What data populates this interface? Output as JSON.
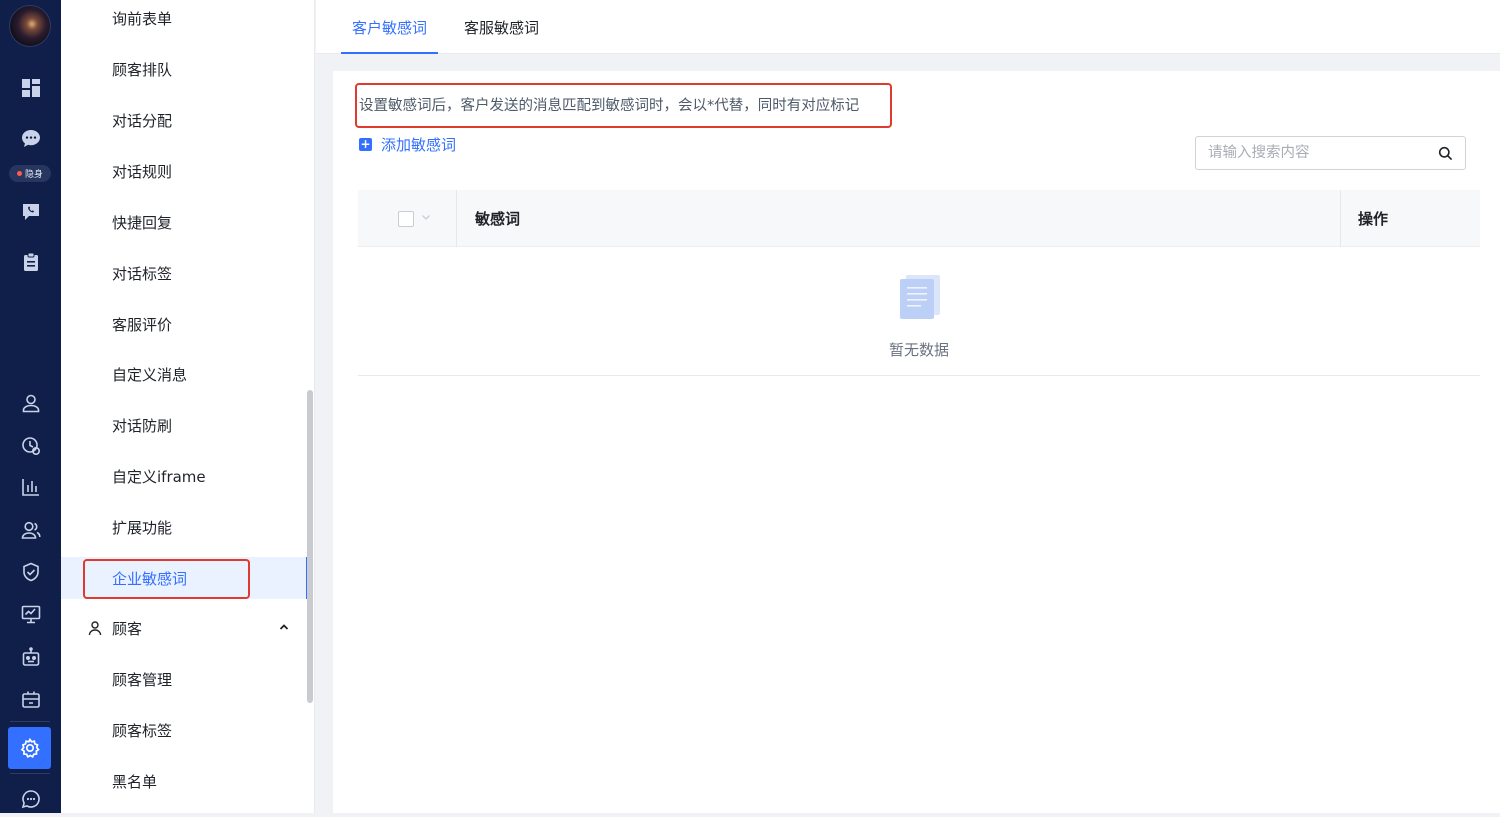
{
  "rail": {
    "status_label": "隐身",
    "icons": [
      "dashboard-icon",
      "chat-icon",
      "phone-chat-icon",
      "clipboard-icon",
      "user-icon",
      "history-icon",
      "bar-chart-icon",
      "team-icon",
      "shield-icon",
      "monitor-icon",
      "robot-icon",
      "grid-app-icon",
      "settings-icon",
      "message-icon"
    ],
    "colors": {
      "background": "#0f1f4a",
      "active": "#3370ff",
      "status_dot": "#ff5a4e"
    }
  },
  "menu": {
    "items": [
      {
        "label": "询前表单"
      },
      {
        "label": "顾客排队"
      },
      {
        "label": "对话分配"
      },
      {
        "label": "对话规则"
      },
      {
        "label": "快捷回复"
      },
      {
        "label": "对话标签"
      },
      {
        "label": "客服评价"
      },
      {
        "label": "自定义消息"
      },
      {
        "label": "对话防刷"
      },
      {
        "label": "自定义iframe"
      },
      {
        "label": "扩展功能"
      },
      {
        "label": "企业敏感词",
        "selected": true
      }
    ],
    "group": {
      "label": "顾客",
      "expanded": true,
      "items": [
        {
          "label": "顾客管理"
        },
        {
          "label": "顾客标签"
        },
        {
          "label": "黑名单"
        }
      ]
    }
  },
  "tabs": [
    {
      "label": "客户敏感词",
      "active": true
    },
    {
      "label": "客服敏感词",
      "active": false
    }
  ],
  "content": {
    "hint": "设置敏感词后，客户发送的消息匹配到敏感词时，会以*代替，同时有对应标记",
    "add_label": "添加敏感词",
    "search": {
      "placeholder": "请输入搜索内容",
      "value": ""
    },
    "table": {
      "columns": [
        "敏感词",
        "操作"
      ],
      "rows": [],
      "empty_text": "暂无数据"
    }
  },
  "colors": {
    "accent": "#3370ff",
    "highlight_box": "#e03a2e"
  }
}
